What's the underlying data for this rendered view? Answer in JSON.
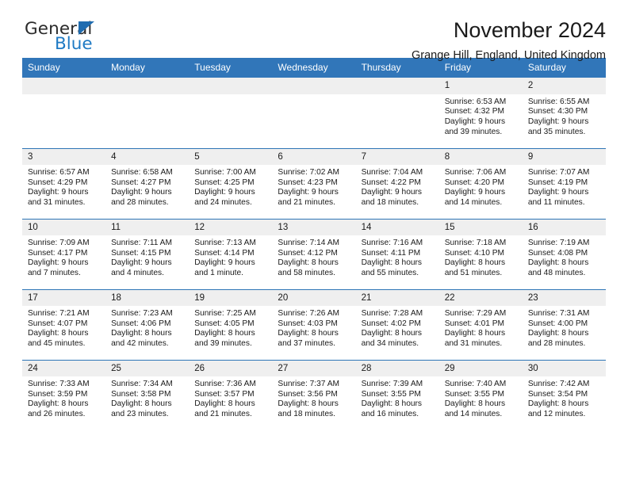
{
  "logo": {
    "word1": "General",
    "word2": "Blue",
    "triangle_color": "#1f6cb0",
    "blue_color": "#1f7ac4"
  },
  "header": {
    "title": "November 2024",
    "subtitle": "Grange Hill, England, United Kingdom",
    "header_bg": "#3176b9",
    "daynum_bg": "#efefef",
    "row_border": "#2e75b6"
  },
  "weekday_headers": [
    "Sunday",
    "Monday",
    "Tuesday",
    "Wednesday",
    "Thursday",
    "Friday",
    "Saturday"
  ],
  "labels": {
    "sunrise": "Sunrise:",
    "sunset": "Sunset:",
    "daylight": "Daylight:"
  },
  "weeks": [
    [
      {
        "empty": true
      },
      {
        "empty": true
      },
      {
        "empty": true
      },
      {
        "empty": true
      },
      {
        "empty": true
      },
      {
        "day": "1",
        "sunrise": "Sunrise: 6:53 AM",
        "sunset": "Sunset: 4:32 PM",
        "daylight_line1": "Daylight: 9 hours",
        "daylight_line2": "and 39 minutes."
      },
      {
        "day": "2",
        "sunrise": "Sunrise: 6:55 AM",
        "sunset": "Sunset: 4:30 PM",
        "daylight_line1": "Daylight: 9 hours",
        "daylight_line2": "and 35 minutes."
      }
    ],
    [
      {
        "day": "3",
        "sunrise": "Sunrise: 6:57 AM",
        "sunset": "Sunset: 4:29 PM",
        "daylight_line1": "Daylight: 9 hours",
        "daylight_line2": "and 31 minutes."
      },
      {
        "day": "4",
        "sunrise": "Sunrise: 6:58 AM",
        "sunset": "Sunset: 4:27 PM",
        "daylight_line1": "Daylight: 9 hours",
        "daylight_line2": "and 28 minutes."
      },
      {
        "day": "5",
        "sunrise": "Sunrise: 7:00 AM",
        "sunset": "Sunset: 4:25 PM",
        "daylight_line1": "Daylight: 9 hours",
        "daylight_line2": "and 24 minutes."
      },
      {
        "day": "6",
        "sunrise": "Sunrise: 7:02 AM",
        "sunset": "Sunset: 4:23 PM",
        "daylight_line1": "Daylight: 9 hours",
        "daylight_line2": "and 21 minutes."
      },
      {
        "day": "7",
        "sunrise": "Sunrise: 7:04 AM",
        "sunset": "Sunset: 4:22 PM",
        "daylight_line1": "Daylight: 9 hours",
        "daylight_line2": "and 18 minutes."
      },
      {
        "day": "8",
        "sunrise": "Sunrise: 7:06 AM",
        "sunset": "Sunset: 4:20 PM",
        "daylight_line1": "Daylight: 9 hours",
        "daylight_line2": "and 14 minutes."
      },
      {
        "day": "9",
        "sunrise": "Sunrise: 7:07 AM",
        "sunset": "Sunset: 4:19 PM",
        "daylight_line1": "Daylight: 9 hours",
        "daylight_line2": "and 11 minutes."
      }
    ],
    [
      {
        "day": "10",
        "sunrise": "Sunrise: 7:09 AM",
        "sunset": "Sunset: 4:17 PM",
        "daylight_line1": "Daylight: 9 hours",
        "daylight_line2": "and 7 minutes."
      },
      {
        "day": "11",
        "sunrise": "Sunrise: 7:11 AM",
        "sunset": "Sunset: 4:15 PM",
        "daylight_line1": "Daylight: 9 hours",
        "daylight_line2": "and 4 minutes."
      },
      {
        "day": "12",
        "sunrise": "Sunrise: 7:13 AM",
        "sunset": "Sunset: 4:14 PM",
        "daylight_line1": "Daylight: 9 hours",
        "daylight_line2": "and 1 minute."
      },
      {
        "day": "13",
        "sunrise": "Sunrise: 7:14 AM",
        "sunset": "Sunset: 4:12 PM",
        "daylight_line1": "Daylight: 8 hours",
        "daylight_line2": "and 58 minutes."
      },
      {
        "day": "14",
        "sunrise": "Sunrise: 7:16 AM",
        "sunset": "Sunset: 4:11 PM",
        "daylight_line1": "Daylight: 8 hours",
        "daylight_line2": "and 55 minutes."
      },
      {
        "day": "15",
        "sunrise": "Sunrise: 7:18 AM",
        "sunset": "Sunset: 4:10 PM",
        "daylight_line1": "Daylight: 8 hours",
        "daylight_line2": "and 51 minutes."
      },
      {
        "day": "16",
        "sunrise": "Sunrise: 7:19 AM",
        "sunset": "Sunset: 4:08 PM",
        "daylight_line1": "Daylight: 8 hours",
        "daylight_line2": "and 48 minutes."
      }
    ],
    [
      {
        "day": "17",
        "sunrise": "Sunrise: 7:21 AM",
        "sunset": "Sunset: 4:07 PM",
        "daylight_line1": "Daylight: 8 hours",
        "daylight_line2": "and 45 minutes."
      },
      {
        "day": "18",
        "sunrise": "Sunrise: 7:23 AM",
        "sunset": "Sunset: 4:06 PM",
        "daylight_line1": "Daylight: 8 hours",
        "daylight_line2": "and 42 minutes."
      },
      {
        "day": "19",
        "sunrise": "Sunrise: 7:25 AM",
        "sunset": "Sunset: 4:05 PM",
        "daylight_line1": "Daylight: 8 hours",
        "daylight_line2": "and 39 minutes."
      },
      {
        "day": "20",
        "sunrise": "Sunrise: 7:26 AM",
        "sunset": "Sunset: 4:03 PM",
        "daylight_line1": "Daylight: 8 hours",
        "daylight_line2": "and 37 minutes."
      },
      {
        "day": "21",
        "sunrise": "Sunrise: 7:28 AM",
        "sunset": "Sunset: 4:02 PM",
        "daylight_line1": "Daylight: 8 hours",
        "daylight_line2": "and 34 minutes."
      },
      {
        "day": "22",
        "sunrise": "Sunrise: 7:29 AM",
        "sunset": "Sunset: 4:01 PM",
        "daylight_line1": "Daylight: 8 hours",
        "daylight_line2": "and 31 minutes."
      },
      {
        "day": "23",
        "sunrise": "Sunrise: 7:31 AM",
        "sunset": "Sunset: 4:00 PM",
        "daylight_line1": "Daylight: 8 hours",
        "daylight_line2": "and 28 minutes."
      }
    ],
    [
      {
        "day": "24",
        "sunrise": "Sunrise: 7:33 AM",
        "sunset": "Sunset: 3:59 PM",
        "daylight_line1": "Daylight: 8 hours",
        "daylight_line2": "and 26 minutes."
      },
      {
        "day": "25",
        "sunrise": "Sunrise: 7:34 AM",
        "sunset": "Sunset: 3:58 PM",
        "daylight_line1": "Daylight: 8 hours",
        "daylight_line2": "and 23 minutes."
      },
      {
        "day": "26",
        "sunrise": "Sunrise: 7:36 AM",
        "sunset": "Sunset: 3:57 PM",
        "daylight_line1": "Daylight: 8 hours",
        "daylight_line2": "and 21 minutes."
      },
      {
        "day": "27",
        "sunrise": "Sunrise: 7:37 AM",
        "sunset": "Sunset: 3:56 PM",
        "daylight_line1": "Daylight: 8 hours",
        "daylight_line2": "and 18 minutes."
      },
      {
        "day": "28",
        "sunrise": "Sunrise: 7:39 AM",
        "sunset": "Sunset: 3:55 PM",
        "daylight_line1": "Daylight: 8 hours",
        "daylight_line2": "and 16 minutes."
      },
      {
        "day": "29",
        "sunrise": "Sunrise: 7:40 AM",
        "sunset": "Sunset: 3:55 PM",
        "daylight_line1": "Daylight: 8 hours",
        "daylight_line2": "and 14 minutes."
      },
      {
        "day": "30",
        "sunrise": "Sunrise: 7:42 AM",
        "sunset": "Sunset: 3:54 PM",
        "daylight_line1": "Daylight: 8 hours",
        "daylight_line2": "and 12 minutes."
      }
    ]
  ]
}
